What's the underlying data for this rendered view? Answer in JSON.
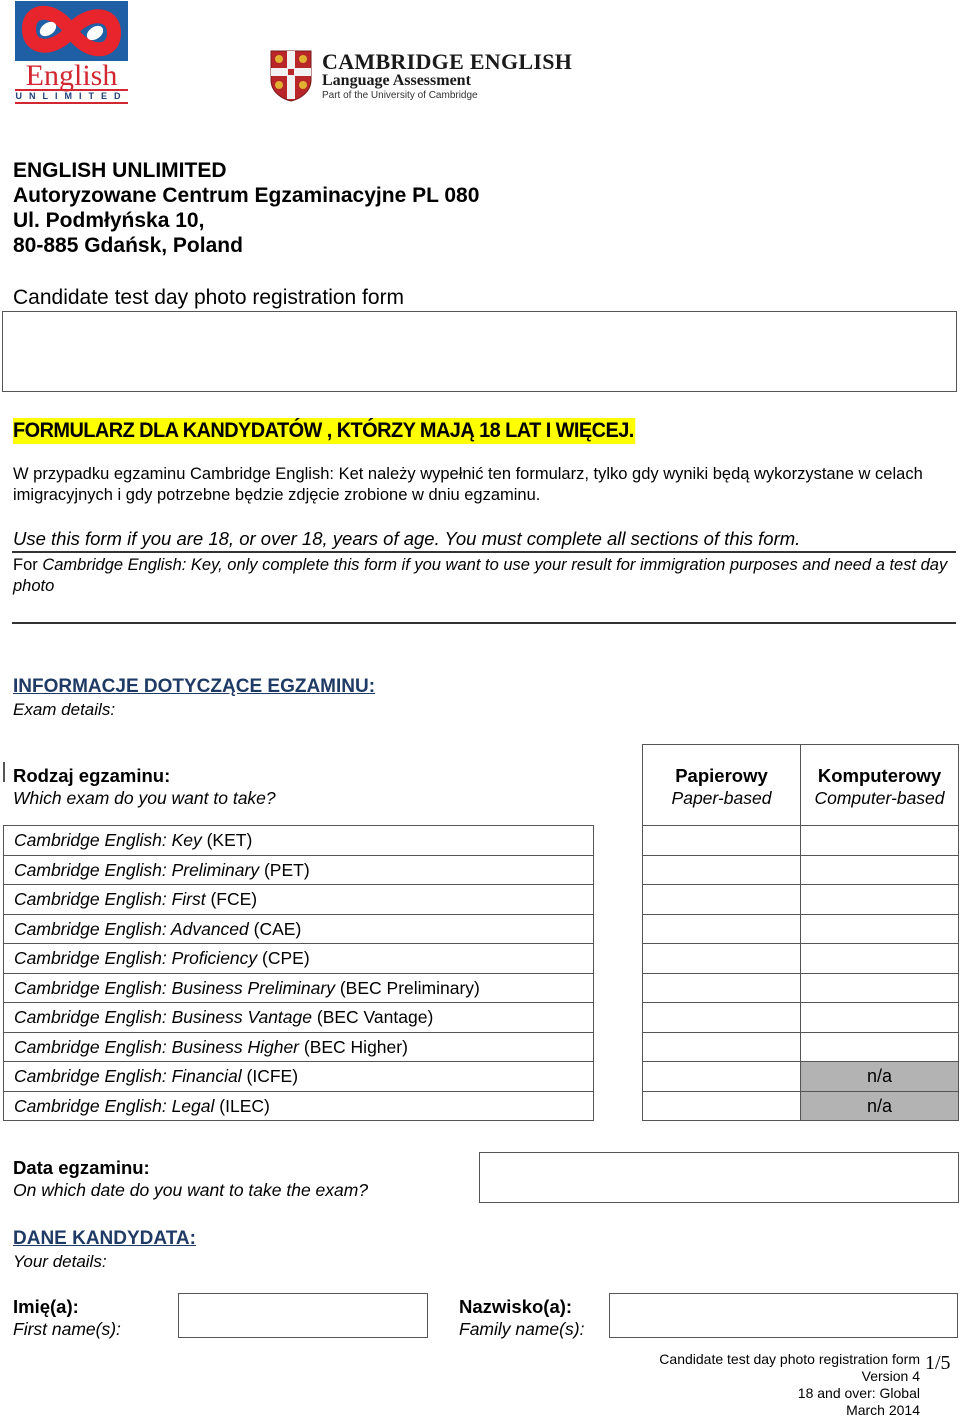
{
  "logos": {
    "english_unlimited": {
      "word": "English",
      "sub": "UNLIMITED",
      "brand_blue": "#1f5fa6",
      "brand_red": "#d22630"
    },
    "cambridge": {
      "title": "CAMBRIDGE ENGLISH",
      "subtitle": "Language Assessment",
      "part_of": "Part of the University of Cambridge"
    }
  },
  "header": {
    "lines": [
      "ENGLISH UNLIMITED",
      "Autoryzowane Centrum Egzaminacyjne PL 080",
      "Ul. Podmłyńska 10,",
      "80-885 Gdańsk, Poland"
    ],
    "form_title": "Candidate test day photo registration form"
  },
  "notice": {
    "highlight": "FORMULARZ DLA KANDYDATÓW , KTÓRZY MAJĄ 18 LAT I  WIĘCEJ.",
    "highlight_color": "#ffff00",
    "polish_paragraph": "W przypadku egzaminu Cambridge English: Ket należy wypełnić ten formularz, tylko gdy wyniki będą wykorzystane w celach imigracyjnych i gdy potrzebne będzie zdjęcie zrobione w dniu egzaminu.",
    "use_line": "Use this form if you are 18, or over 18, years of age. You must complete all sections of this form.",
    "for_prefix": "For",
    "for_text": "Cambridge English: Key, only complete this form if you want to use your result for immigration purposes and need a test day photo"
  },
  "exam_details": {
    "heading": "INFORMACJE DOTYCZĄCE EGZAMINU:",
    "subheading": "Exam details:",
    "heading_color": "#1f3a64",
    "exam_type_label": "Rodzaj egzaminu:",
    "exam_type_question": "Which exam do you want to take?",
    "columns": [
      {
        "label": "Papierowy",
        "sub": "Paper-based"
      },
      {
        "label": "Komputerowy",
        "sub": "Computer-based"
      }
    ],
    "exams": [
      {
        "name": "Cambridge English: Key",
        "code": "(KET)",
        "paper": "",
        "computer": ""
      },
      {
        "name": "Cambridge English: Preliminary",
        "code": "(PET)",
        "paper": "",
        "computer": ""
      },
      {
        "name": "Cambridge English: First",
        "code": "(FCE)",
        "paper": "",
        "computer": ""
      },
      {
        "name": "Cambridge English: Advanced",
        "code": "(CAE)",
        "paper": "",
        "computer": ""
      },
      {
        "name": "Cambridge English: Proficiency",
        "code": "(CPE)",
        "paper": "",
        "computer": ""
      },
      {
        "name": "Cambridge English: Business Preliminary",
        "code": "(BEC Preliminary)",
        "paper": "",
        "computer": ""
      },
      {
        "name": "Cambridge English: Business Vantage",
        "code": "(BEC Vantage)",
        "paper": "",
        "computer": ""
      },
      {
        "name": "Cambridge English: Business Higher",
        "code": "(BEC Higher)",
        "paper": "",
        "computer": ""
      },
      {
        "name": "Cambridge English: Financial",
        "code": "(ICFE)",
        "paper": "",
        "computer": "n/a"
      },
      {
        "name": "Cambridge English: Legal",
        "code": "(ILEC)",
        "paper": "",
        "computer": "n/a"
      }
    ],
    "na_color": "#b3b3b3",
    "date_label": "Data egzaminu:",
    "date_question": "On which date do you want to take the exam?",
    "date_value": ""
  },
  "candidate": {
    "heading": "DANE KANDYDATA:",
    "subheading": "Your details:",
    "first_name_label": "Imię(a):",
    "first_name_sub": "First name(s):",
    "first_name_value": "",
    "family_name_label": "Nazwisko(a):",
    "family_name_sub": "Family name(s):",
    "family_name_value": ""
  },
  "footer": {
    "lines": [
      "Candidate test day photo registration form",
      "Version 4",
      "18 and over: Global",
      "March 2014"
    ],
    "page": "1/5"
  }
}
